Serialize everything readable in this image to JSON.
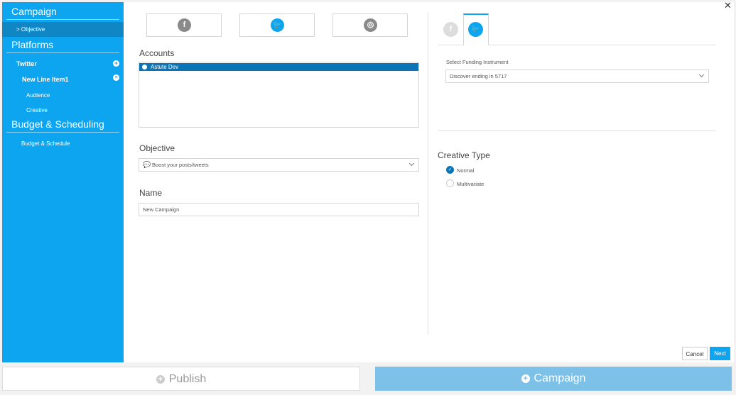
{
  "sidebar": {
    "campaign": "Campaign",
    "objective": "> Objective",
    "platforms": "Platforms",
    "twitter": "Twitter",
    "line_item": "New Line Item1",
    "audience": "Audience",
    "creative": "Creative",
    "budget_head": "Budget & Scheduling",
    "budget_item": "Budget & Schedule"
  },
  "platforms": {
    "facebook_glyph": "f",
    "twitter_glyph": "🐦",
    "instagram_glyph": "◎"
  },
  "accounts": {
    "label": "Accounts",
    "items": [
      "Astute Dev"
    ]
  },
  "objective": {
    "label": "Objective",
    "value": "Boost your posts/tweets"
  },
  "name": {
    "label": "Name",
    "value": "New Campaign"
  },
  "funding": {
    "label": "Select Funding Instrument",
    "value": "Discover ending in 5717"
  },
  "creative_type": {
    "label": "Creative Type",
    "options": [
      "Normal",
      "Multivariate"
    ],
    "selected": "Normal"
  },
  "buttons": {
    "cancel": "Cancel",
    "next": "Next",
    "publish": "Publish",
    "campaign": "Campaign"
  },
  "colors": {
    "accent": "#0ea5f0",
    "active_row": "#0b74b6"
  }
}
